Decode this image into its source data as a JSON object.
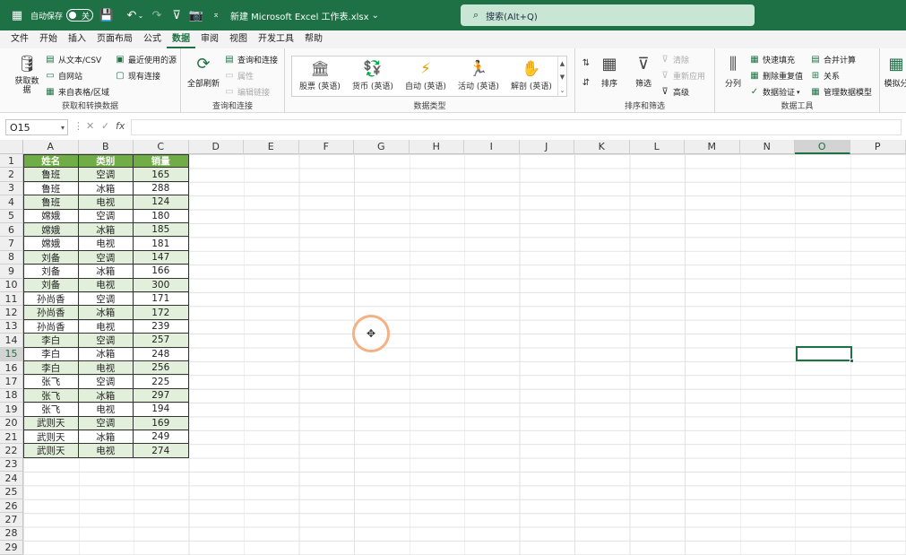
{
  "titlebar": {
    "autosave_label": "自动保存",
    "autosave_state": "关",
    "filename": "新建 Microsoft Excel 工作表.xlsx",
    "filename_dropdown": "⌄",
    "search_placeholder": "搜索(Alt+Q)",
    "accent": "#1e7145"
  },
  "menu": [
    "文件",
    "开始",
    "插入",
    "页面布局",
    "公式",
    "数据",
    "审阅",
    "视图",
    "开发工具",
    "帮助"
  ],
  "active_menu": "数据",
  "ribbon": {
    "get_data": {
      "big_label": "获取数据",
      "small_labels": [
        "从文本/CSV",
        "自网站",
        "来自表格/区域",
        "最近使用的源",
        "现有连接"
      ],
      "group_label": "获取和转换数据"
    },
    "queries": {
      "big_label": "全部刷新",
      "small_labels": [
        "查询和连接",
        "属性",
        "编辑链接"
      ],
      "group_label": "查询和连接"
    },
    "datatypes": {
      "items": [
        "股票 (英语)",
        "货币 (英语)",
        "自动 (英语)",
        "活动 (英语)",
        "解剖 (英语)"
      ],
      "group_label": "数据类型"
    },
    "sort": {
      "sort_label": "排序",
      "filter_label": "筛选",
      "small_labels": [
        "清除",
        "重新应用",
        "高级"
      ],
      "group_label": "排序和筛选"
    },
    "tools": {
      "split_label": "分列",
      "small_labels": [
        "快速填充",
        "删除重复值",
        "数据验证",
        "合并计算",
        "关系",
        "管理数据模型"
      ],
      "group_label": "数据工具"
    },
    "whatif_label": "模拟分"
  },
  "formula_bar": {
    "namebox": "O15",
    "fx": "fx",
    "value": ""
  },
  "columns": [
    "A",
    "B",
    "C",
    "D",
    "E",
    "F",
    "G",
    "H",
    "I",
    "J",
    "K",
    "L",
    "M",
    "N",
    "O",
    "P"
  ],
  "selected_column": "O",
  "selected_row": 15,
  "rows": [
    "1",
    "2",
    "3",
    "4",
    "5",
    "6",
    "7",
    "8",
    "9",
    "10",
    "11",
    "12",
    "13",
    "14",
    "15",
    "16",
    "17",
    "18",
    "19",
    "20",
    "21",
    "22",
    "23",
    "24",
    "25",
    "26",
    "27",
    "28",
    "29"
  ],
  "table": {
    "headers": [
      "姓名",
      "类别",
      "销量"
    ],
    "rows": [
      [
        "鲁班",
        "空调",
        "165"
      ],
      [
        "鲁班",
        "冰箱",
        "288"
      ],
      [
        "鲁班",
        "电视",
        "124"
      ],
      [
        "嫦娥",
        "空调",
        "180"
      ],
      [
        "嫦娥",
        "冰箱",
        "185"
      ],
      [
        "嫦娥",
        "电视",
        "181"
      ],
      [
        "刘备",
        "空调",
        "147"
      ],
      [
        "刘备",
        "冰箱",
        "166"
      ],
      [
        "刘备",
        "电视",
        "300"
      ],
      [
        "孙尚香",
        "空调",
        "171"
      ],
      [
        "孙尚香",
        "冰箱",
        "172"
      ],
      [
        "孙尚香",
        "电视",
        "239"
      ],
      [
        "李白",
        "空调",
        "257"
      ],
      [
        "李白",
        "冰箱",
        "248"
      ],
      [
        "李白",
        "电视",
        "256"
      ],
      [
        "张飞",
        "空调",
        "225"
      ],
      [
        "张飞",
        "冰箱",
        "297"
      ],
      [
        "张飞",
        "电视",
        "194"
      ],
      [
        "武则天",
        "空调",
        "169"
      ],
      [
        "武则天",
        "冰箱",
        "249"
      ],
      [
        "武则天",
        "电视",
        "274"
      ]
    ],
    "header_color": "#70ad47",
    "band_color": "#e2efda"
  }
}
